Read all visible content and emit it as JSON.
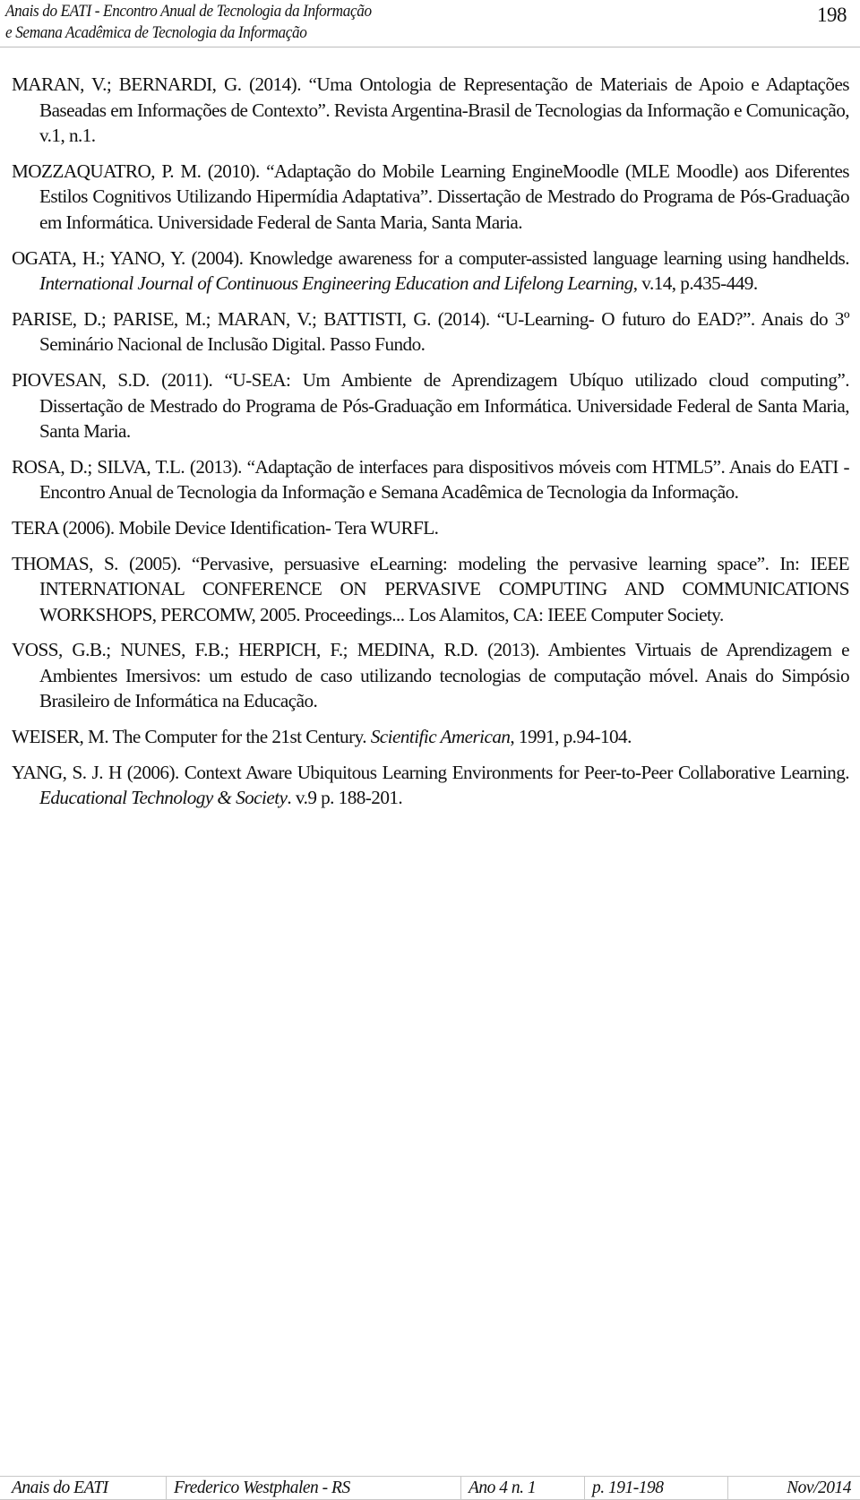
{
  "header": {
    "title_line1": "Anais do EATI - Encontro Anual de Tecnologia da Informação",
    "title_line2": "e Semana Acadêmica de Tecnologia da Informação",
    "page_number": "198"
  },
  "references": [
    {
      "segments": [
        {
          "text": "MARAN, V.; BERNARDI, G. (2014). “Uma Ontologia de Representação de Materiais de Apoio e Adaptações Baseadas em Informações de Contexto”. Revista Argentina-Brasil de Tecnologias da Informação e Comunicação, v.1, n.1.",
          "italic": false
        }
      ]
    },
    {
      "segments": [
        {
          "text": "MOZZAQUATRO, P. M. (2010). “Adaptação do Mobile Learning EngineMoodle (MLE Moodle) aos Diferentes Estilos Cognitivos Utilizando Hipermídia Adaptativa”. Dissertação de Mestrado do Programa de Pós-Graduação em Informática. Universidade Federal de Santa Maria, Santa Maria.",
          "italic": false
        }
      ]
    },
    {
      "segments": [
        {
          "text": "OGATA, H.; YANO, Y. (2004). Knowledge awareness for a computer-assisted language learning using handhelds. ",
          "italic": false
        },
        {
          "text": "International Journal of Continuous Engineering Education and Lifelong Learning",
          "italic": true
        },
        {
          "text": ", v.14, p.435-449.",
          "italic": false
        }
      ]
    },
    {
      "segments": [
        {
          "text": "PARISE, D.; PARISE, M.; MARAN, V.; BATTISTI, G. (2014). “U-Learning- O futuro do EAD?”. Anais do 3º Seminário Nacional de Inclusão Digital. Passo Fundo.",
          "italic": false
        }
      ]
    },
    {
      "segments": [
        {
          "text": "PIOVESAN, S.D. (2011). “U-SEA: Um Ambiente de Aprendizagem Ubíquo utilizado cloud computing”. Dissertação de Mestrado do Programa de Pós-Graduação em Informática. Universidade Federal de Santa Maria, Santa Maria.",
          "italic": false
        }
      ]
    },
    {
      "segments": [
        {
          "text": "ROSA, D.; SILVA, T.L. (2013). “Adaptação de interfaces para dispositivos móveis com HTML5”. Anais do EATI - Encontro Anual de Tecnologia da Informação e Semana Acadêmica de Tecnologia da Informação.",
          "italic": false
        }
      ]
    },
    {
      "segments": [
        {
          "text": "TERA (2006). Mobile Device Identification- Tera WURFL.",
          "italic": false
        }
      ]
    },
    {
      "segments": [
        {
          "text": "THOMAS, S. (2005). “Pervasive, persuasive eLearning: modeling the pervasive learning space”. In: IEEE INTERNATIONAL CONFERENCE ON PERVASIVE COMPUTING AND COMMUNICATIONS WORKSHOPS, PERCOMW, 2005. Proceedings... Los Alamitos, CA: IEEE Computer Society.",
          "italic": false
        }
      ]
    },
    {
      "segments": [
        {
          "text": "VOSS, G.B.; NUNES, F.B.; HERPICH, F.; MEDINA, R.D. (2013). Ambientes Virtuais de Aprendizagem e Ambientes Imersivos: um estudo de caso utilizando tecnologias de computação móvel. Anais do Simpósio Brasileiro de Informática na Educação.",
          "italic": false
        }
      ]
    },
    {
      "segments": [
        {
          "text": "WEISER, M. The Computer for the 21st Century. ",
          "italic": false
        },
        {
          "text": "Scientific American",
          "italic": true
        },
        {
          "text": ", 1991, p.94-104.",
          "italic": false
        }
      ]
    },
    {
      "segments": [
        {
          "text": "YANG, S. J. H (2006). Context Aware Ubiquitous Learning Environments for Peer-to-Peer Collaborative Learning. ",
          "italic": false
        },
        {
          "text": "Educational Technology & Society",
          "italic": true
        },
        {
          "text": ". v.9 p. 188-201.",
          "italic": false
        }
      ]
    }
  ],
  "footer": {
    "cells": [
      "Anais do EATI",
      "Frederico Westphalen - RS",
      "Ano 4 n. 1",
      "p. 191-198",
      "Nov/2014"
    ]
  }
}
